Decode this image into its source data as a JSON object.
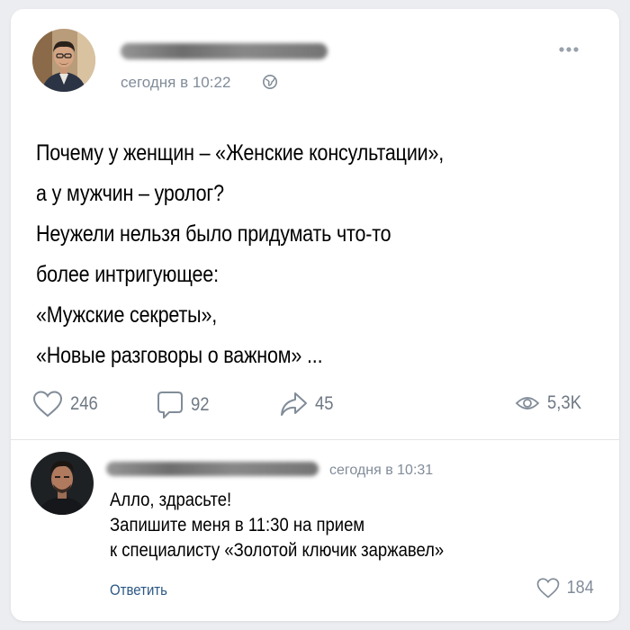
{
  "post": {
    "time": "сегодня в 10:22",
    "text_lines": [
      "Почему у женщин – «Женские консультации»,",
      "а у мужчин – уролог?",
      "Неужели нельзя было придумать что-то",
      "более интригующее:",
      "«Мужские секреты»,",
      "«Новые разговоры о важном» ..."
    ],
    "likes": "246",
    "comments": "92",
    "shares": "45",
    "views": "5,3K"
  },
  "comment": {
    "time": "сегодня в 10:31",
    "text_lines": [
      "Алло, здрасьте!",
      "Запишите меня в 11:30 на прием",
      "к специалисту «Золотой ключик заржавел»"
    ],
    "reply_label": "Ответить",
    "likes": "184"
  },
  "icons": {
    "globe": "globe-icon",
    "more": "more-icon",
    "like": "heart-icon",
    "comment": "comment-icon",
    "share": "share-icon",
    "views": "eye-icon"
  },
  "colors": {
    "accent": "#2a5885",
    "muted": "#818c99"
  }
}
